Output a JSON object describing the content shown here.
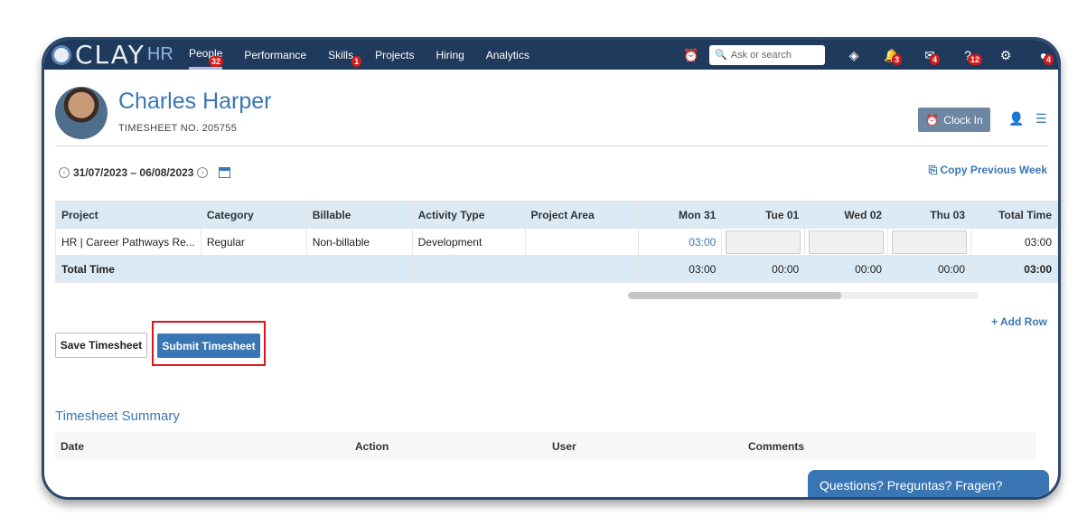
{
  "brand": {
    "logo_main": "CLAY",
    "logo_sub": "HR"
  },
  "nav": {
    "items": [
      {
        "label": "People",
        "badge": "32"
      },
      {
        "label": "Performance"
      },
      {
        "label": "Skills",
        "badge": "1"
      },
      {
        "label": "Projects"
      },
      {
        "label": "Hiring"
      },
      {
        "label": "Analytics"
      }
    ],
    "active": "People"
  },
  "topbar": {
    "search_placeholder": "Ask or search",
    "icons": [
      {
        "name": "clock-icon"
      },
      {
        "name": "learning-icon"
      },
      {
        "name": "bell-icon",
        "badge": "3"
      },
      {
        "name": "mail-icon",
        "badge": "4"
      },
      {
        "name": "help-icon",
        "badge": "12"
      },
      {
        "name": "gear-icon"
      },
      {
        "name": "profile-menu-icon",
        "badge": "4"
      }
    ]
  },
  "employee": {
    "name": "Charles Harper",
    "timesheet_label": "TIMESHEET NO. 205755"
  },
  "actions": {
    "clock_in": "Clock In"
  },
  "week": {
    "range": "31/07/2023 – 06/08/2023",
    "copy_previous": "Copy Previous Week"
  },
  "table": {
    "headers": [
      "Project",
      "Category",
      "Billable",
      "Activity Type",
      "Project Area",
      "Mon 31",
      "Tue 01",
      "Wed 02",
      "Thu 03",
      "Total Time"
    ],
    "row": {
      "project": "HR | Career Pathways Re...",
      "category": "Regular",
      "billable": "Non-billable",
      "activity": "Development",
      "area": "",
      "mon": "03:00",
      "total": "03:00"
    },
    "totals": {
      "label": "Total Time",
      "mon": "03:00",
      "tue": "00:00",
      "wed": "00:00",
      "thu": "00:00",
      "total": "03:00"
    }
  },
  "buttons": {
    "add_row": "+ Add Row",
    "save": "Save Timesheet",
    "submit": "Submit Timesheet"
  },
  "summary": {
    "title": "Timesheet Summary",
    "headers": [
      "Date",
      "Action",
      "User",
      "Comments"
    ]
  },
  "chat": {
    "label": "Questions? Preguntas? Fragen?"
  },
  "colors": {
    "nav_bg": "#1f3a5c",
    "accent": "#3a76b4",
    "highlight": "#e0121a"
  }
}
